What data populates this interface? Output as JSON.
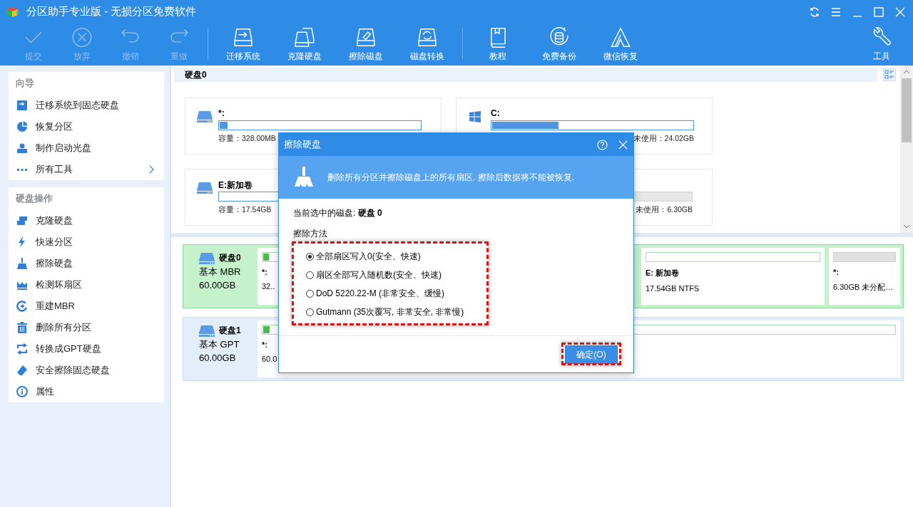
{
  "window": {
    "title": "分区助手专业版 - 无损分区免费软件"
  },
  "toolbar": [
    {
      "label": "提交",
      "kind": "check",
      "disabled": true
    },
    {
      "label": "放弃",
      "kind": "cancel",
      "disabled": true
    },
    {
      "label": "撤销",
      "kind": "undo",
      "disabled": true
    },
    {
      "label": "重做",
      "kind": "redo",
      "disabled": true
    },
    {
      "label": "迁移系统",
      "kind": "migrate",
      "disabled": false
    },
    {
      "label": "克隆硬盘",
      "kind": "clone",
      "disabled": false
    },
    {
      "label": "擦除磁盘",
      "kind": "wipe",
      "disabled": false
    },
    {
      "label": "磁盘转换",
      "kind": "convert",
      "disabled": false
    },
    {
      "label": "教程",
      "kind": "book",
      "disabled": false
    },
    {
      "label": "免费备份",
      "kind": "backup",
      "disabled": false
    },
    {
      "label": "微信恢复",
      "kind": "recover",
      "disabled": false
    },
    {
      "label": "工具",
      "kind": "tools",
      "disabled": false
    }
  ],
  "sidebar": {
    "sections": [
      {
        "title": "向导",
        "items": [
          {
            "label": "迁移系统到固态硬盘",
            "kind": "migrate",
            "submenu": false
          },
          {
            "label": "恢复分区",
            "kind": "pie",
            "submenu": false
          },
          {
            "label": "制作启动光盘",
            "kind": "user",
            "submenu": false
          },
          {
            "label": "所有工具",
            "kind": "dots",
            "submenu": true
          }
        ]
      },
      {
        "title": "硬盘操作",
        "items": [
          {
            "label": "克隆硬盘",
            "kind": "clone",
            "submenu": false
          },
          {
            "label": "快速分区",
            "kind": "bolt",
            "submenu": false
          },
          {
            "label": "擦除硬盘",
            "kind": "broom",
            "submenu": false
          },
          {
            "label": "检测坏扇区",
            "kind": "pulse",
            "submenu": false
          },
          {
            "label": "重建MBR",
            "kind": "rebuild",
            "submenu": false
          },
          {
            "label": "删除所有分区",
            "kind": "trash",
            "submenu": false
          },
          {
            "label": "转换成GPT硬盘",
            "kind": "swap",
            "submenu": false
          },
          {
            "label": "安全擦除固态硬盘",
            "kind": "eraser",
            "submenu": false
          },
          {
            "label": "属性",
            "kind": "info",
            "submenu": false
          }
        ]
      }
    ]
  },
  "disk_view": {
    "title": "硬盘0",
    "partitions": [
      {
        "kind": "data",
        "name": "*:",
        "level": 0.04,
        "capacity": "容量：328.00MB"
      },
      {
        "kind": "system",
        "name": "C:",
        "level": 0.33,
        "free": "未使用：24.02GB"
      },
      {
        "kind": "data",
        "name": "E:新加卷",
        "capacity": "容量：17.54GB"
      },
      {
        "kind": "unallocated",
        "free": "未使用：6.30GB"
      }
    ]
  },
  "disks": [
    {
      "name": "硬盘0",
      "type": "基本 MBR",
      "size": "60.00GB",
      "selected": true,
      "partitions": [
        {
          "kind": "partition",
          "name": "*:",
          "info": "32..",
          "level": 0.3
        },
        {
          "kind": "partition",
          "name": "E: 新加卷",
          "info": "17.54GB NTFS"
        },
        {
          "kind": "unallocated",
          "name": "*:",
          "info": "6.30GB 未分配…"
        }
      ]
    },
    {
      "name": "硬盘1",
      "type": "基本 GPT",
      "size": "60.00GB",
      "selected": false,
      "partitions": [
        {
          "kind": "partition",
          "name": "*:",
          "info": "60.0",
          "level": 0.01
        }
      ]
    }
  ],
  "dialog": {
    "title": "擦除硬盘",
    "banner": "删除所有分区并擦除磁盘上的所有扇区. 擦除后数据将不能被恢复.",
    "current_disk": "当前选中的磁盘: **硬盘 0**",
    "method_label": "擦除方法",
    "methods": [
      {
        "label": "全部扇区写入0(安全、快速)",
        "selected": true
      },
      {
        "label": "扇区全部写入随机数(安全、快速)",
        "selected": false
      },
      {
        "label": "DoD 5220.22-M (非常安全、缓慢)",
        "selected": false
      },
      {
        "label": "Gutmann (35次覆写, 非常安全, 非常慢)",
        "selected": false
      }
    ],
    "ok_button": "确定(O)"
  }
}
